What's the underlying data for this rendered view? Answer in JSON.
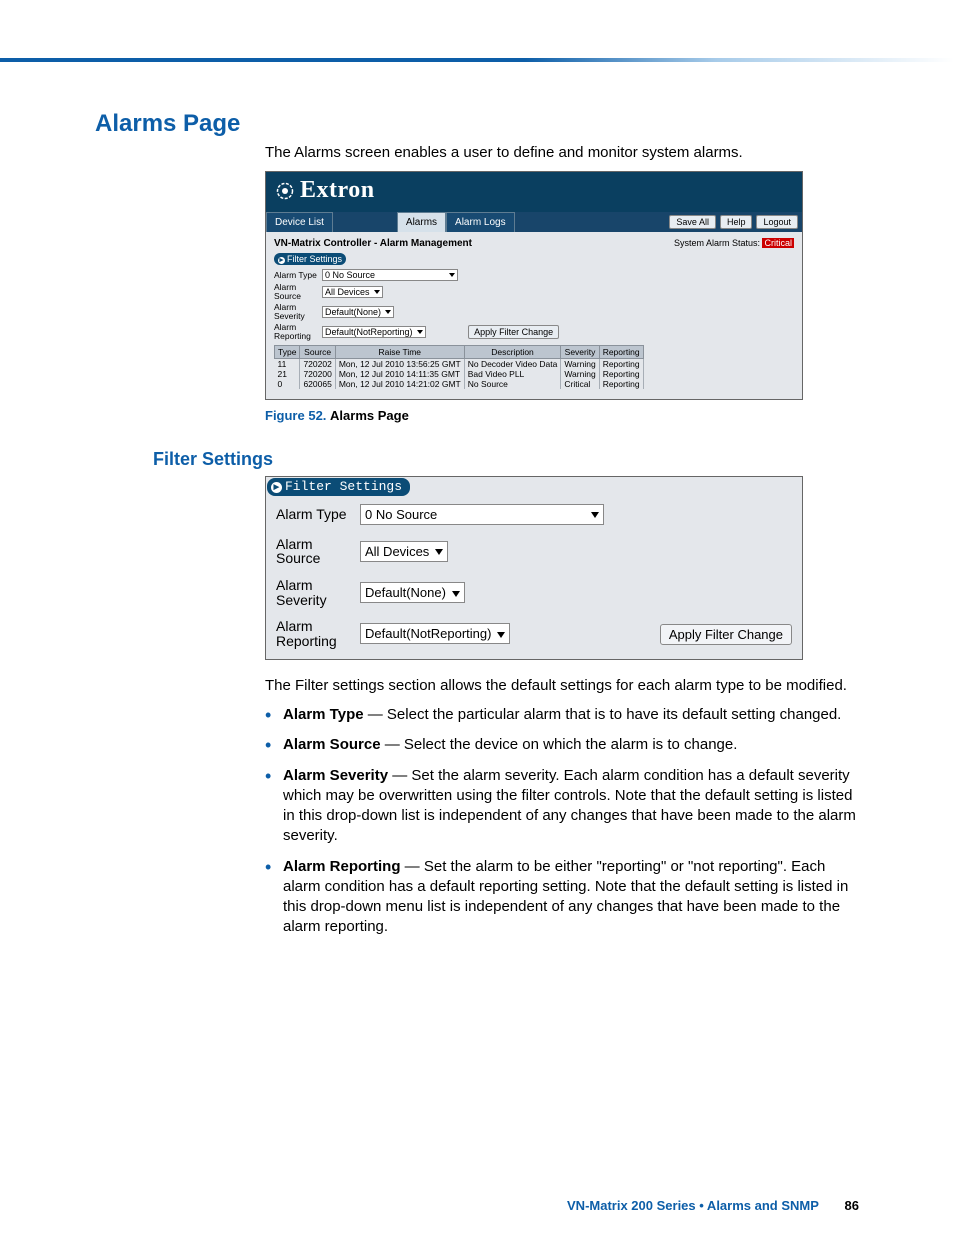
{
  "page_title": "Alarms Page",
  "intro_text": "The Alarms screen enables a user to define and monitor system alarms.",
  "figure": {
    "label": "Figure 52.",
    "name": "Alarms Page"
  },
  "shot1": {
    "brand": "Extron",
    "tabs": {
      "device_list": "Device List",
      "alarms": "Alarms",
      "alarm_logs": "Alarm Logs"
    },
    "right_btns": {
      "save_all": "Save All",
      "help": "Help",
      "logout": "Logout"
    },
    "heading": "VN-Matrix Controller - Alarm Management",
    "status_label": "System Alarm Status:",
    "status_value": "Critical",
    "filter_title": "Filter Settings",
    "labels": {
      "type": "Alarm Type",
      "source": "Alarm Source",
      "severity": "Alarm Severity",
      "reporting": "Alarm Reporting"
    },
    "values": {
      "type": "0 No Source",
      "source": "All Devices",
      "severity": "Default(None)",
      "reporting": "Default(NotReporting)"
    },
    "apply_btn": "Apply Filter Change",
    "table": {
      "headers": {
        "type": "Type",
        "source": "Source",
        "raise_time": "Raise Time",
        "description": "Description",
        "severity": "Severity",
        "reporting": "Reporting"
      },
      "rows": [
        {
          "type": "11",
          "source": "720202",
          "raise_time": "Mon, 12 Jul 2010 13:56:25 GMT",
          "description": "No Decoder Video Data",
          "severity": "Warning",
          "reporting": "Reporting"
        },
        {
          "type": "21",
          "source": "720200",
          "raise_time": "Mon, 12 Jul 2010 14:11:35 GMT",
          "description": "Bad Video PLL",
          "severity": "Warning",
          "reporting": "Reporting"
        },
        {
          "type": "0",
          "source": "620065",
          "raise_time": "Mon, 12 Jul 2010 14:21:02 GMT",
          "description": "No Source",
          "severity": "Critical",
          "reporting": "Reporting"
        }
      ]
    }
  },
  "filter_heading": "Filter Settings",
  "shot2": {
    "title": "Filter Settings",
    "labels": {
      "type": "Alarm Type",
      "source": "Alarm Source",
      "severity": "Alarm Severity",
      "reporting": "Alarm Reporting"
    },
    "values": {
      "type": "0 No Source",
      "source": "All Devices",
      "severity": "Default(None)",
      "reporting": "Default(NotReporting)"
    },
    "apply_btn": "Apply Filter Change"
  },
  "body": {
    "intro": "The Filter settings section allows the default settings for each alarm type to be modified.",
    "items": [
      {
        "term": "Alarm Type",
        "rest": " — Select the particular alarm that is to have its default setting changed."
      },
      {
        "term": "Alarm Source",
        "rest": " — Select the device on which the alarm is to change."
      },
      {
        "term": "Alarm Severity",
        "rest": " — Set the alarm severity. Each alarm condition has a default severity which may be overwritten using the filter controls. Note that the default setting is listed in this drop-down list is independent of any changes that have been made to the alarm severity."
      },
      {
        "term": "Alarm Reporting",
        "rest": " — Set the alarm to be either \"reporting\" or \"not reporting\". Each alarm condition has a default reporting setting. Note that the default setting is listed in this drop-down menu list is independent of any changes that have been made to the alarm reporting."
      }
    ]
  },
  "footer": {
    "text": "VN-Matrix 200 Series  •  Alarms and SNMP",
    "page": "86"
  }
}
